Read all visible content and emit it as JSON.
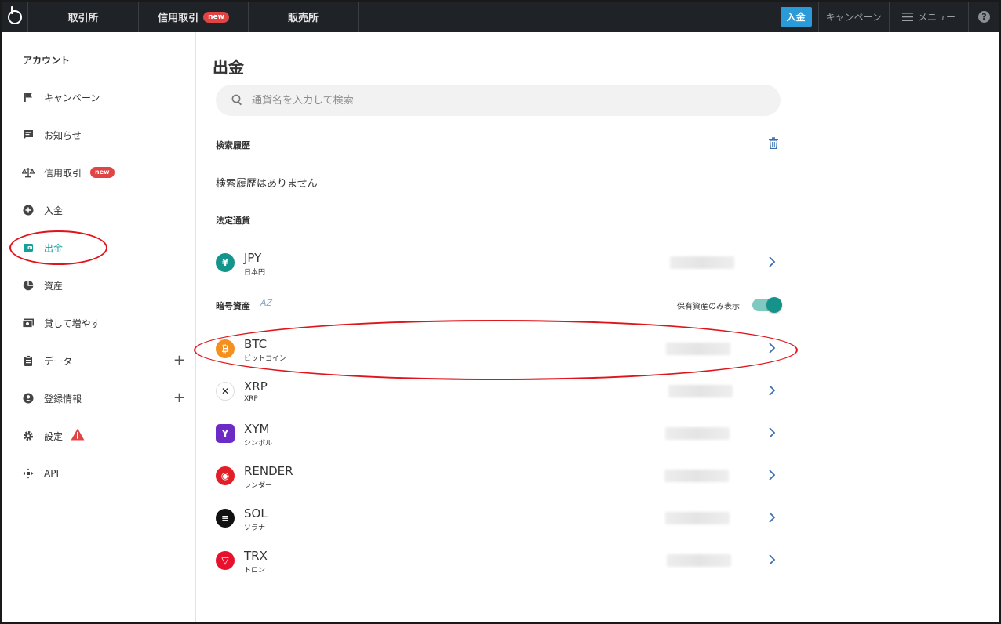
{
  "topnav": {
    "tabs": [
      {
        "label": "取引所"
      },
      {
        "label": "信用取引",
        "badge": "new"
      },
      {
        "label": "販売所"
      }
    ],
    "deposit_label": "入金",
    "campaign_label": "キャンペーン",
    "menu_label": "メニュー",
    "help_glyph": "?"
  },
  "sidebar": {
    "heading": "アカウント",
    "items": [
      {
        "label": "キャンペーン",
        "icon": "flag-icon"
      },
      {
        "label": "お知らせ",
        "icon": "message-icon"
      },
      {
        "label": "信用取引",
        "icon": "scale-icon",
        "badge": "new"
      },
      {
        "label": "入金",
        "icon": "plus-circle-icon"
      },
      {
        "label": "出金",
        "icon": "wallet-icon",
        "active": true
      },
      {
        "label": "資産",
        "icon": "pie-chart-icon"
      },
      {
        "label": "貸して増やす",
        "icon": "cash-icon"
      },
      {
        "label": "データ",
        "icon": "clipboard-icon",
        "expand": "+"
      },
      {
        "label": "登録情報",
        "icon": "user-circle-icon",
        "expand": "+"
      },
      {
        "label": "設定",
        "icon": "gear-icon",
        "warning": true
      },
      {
        "label": "API",
        "icon": "api-icon"
      }
    ]
  },
  "main": {
    "title": "出金",
    "search_placeholder": "通貨名を入力して検索",
    "history_label": "検索履歴",
    "no_history": "検索履歴はありません",
    "fiat_label": "法定通貨",
    "crypto_label": "暗号資産",
    "az_label": "AZ",
    "toggle_label": "保有資産のみ表示",
    "toggle_on": true,
    "fiat": [
      {
        "code": "JPY",
        "name": "日本円",
        "glyph": "¥",
        "color": "#14958c"
      }
    ],
    "crypto": [
      {
        "code": "BTC",
        "name": "ビットコイン",
        "glyph": "₿",
        "color": "#f4901f"
      },
      {
        "code": "XRP",
        "name": "XRP",
        "glyph": "✕",
        "color": "#ffffff"
      },
      {
        "code": "XYM",
        "name": "シンボル",
        "glyph": "Y",
        "color": "#6d2bc6"
      },
      {
        "code": "RENDER",
        "name": "レンダー",
        "glyph": "◉",
        "color": "#e21f26"
      },
      {
        "code": "SOL",
        "name": "ソラナ",
        "glyph": "≡",
        "color": "#111111"
      },
      {
        "code": "TRX",
        "name": "トロン",
        "glyph": "▽",
        "color": "#e8112d"
      }
    ]
  },
  "colors": {
    "accent": "#13a29a",
    "nav_bg": "#1f2226",
    "deposit_btn": "#2a9ad8",
    "badge_red": "#e04444",
    "annotation": "#e0151b"
  }
}
